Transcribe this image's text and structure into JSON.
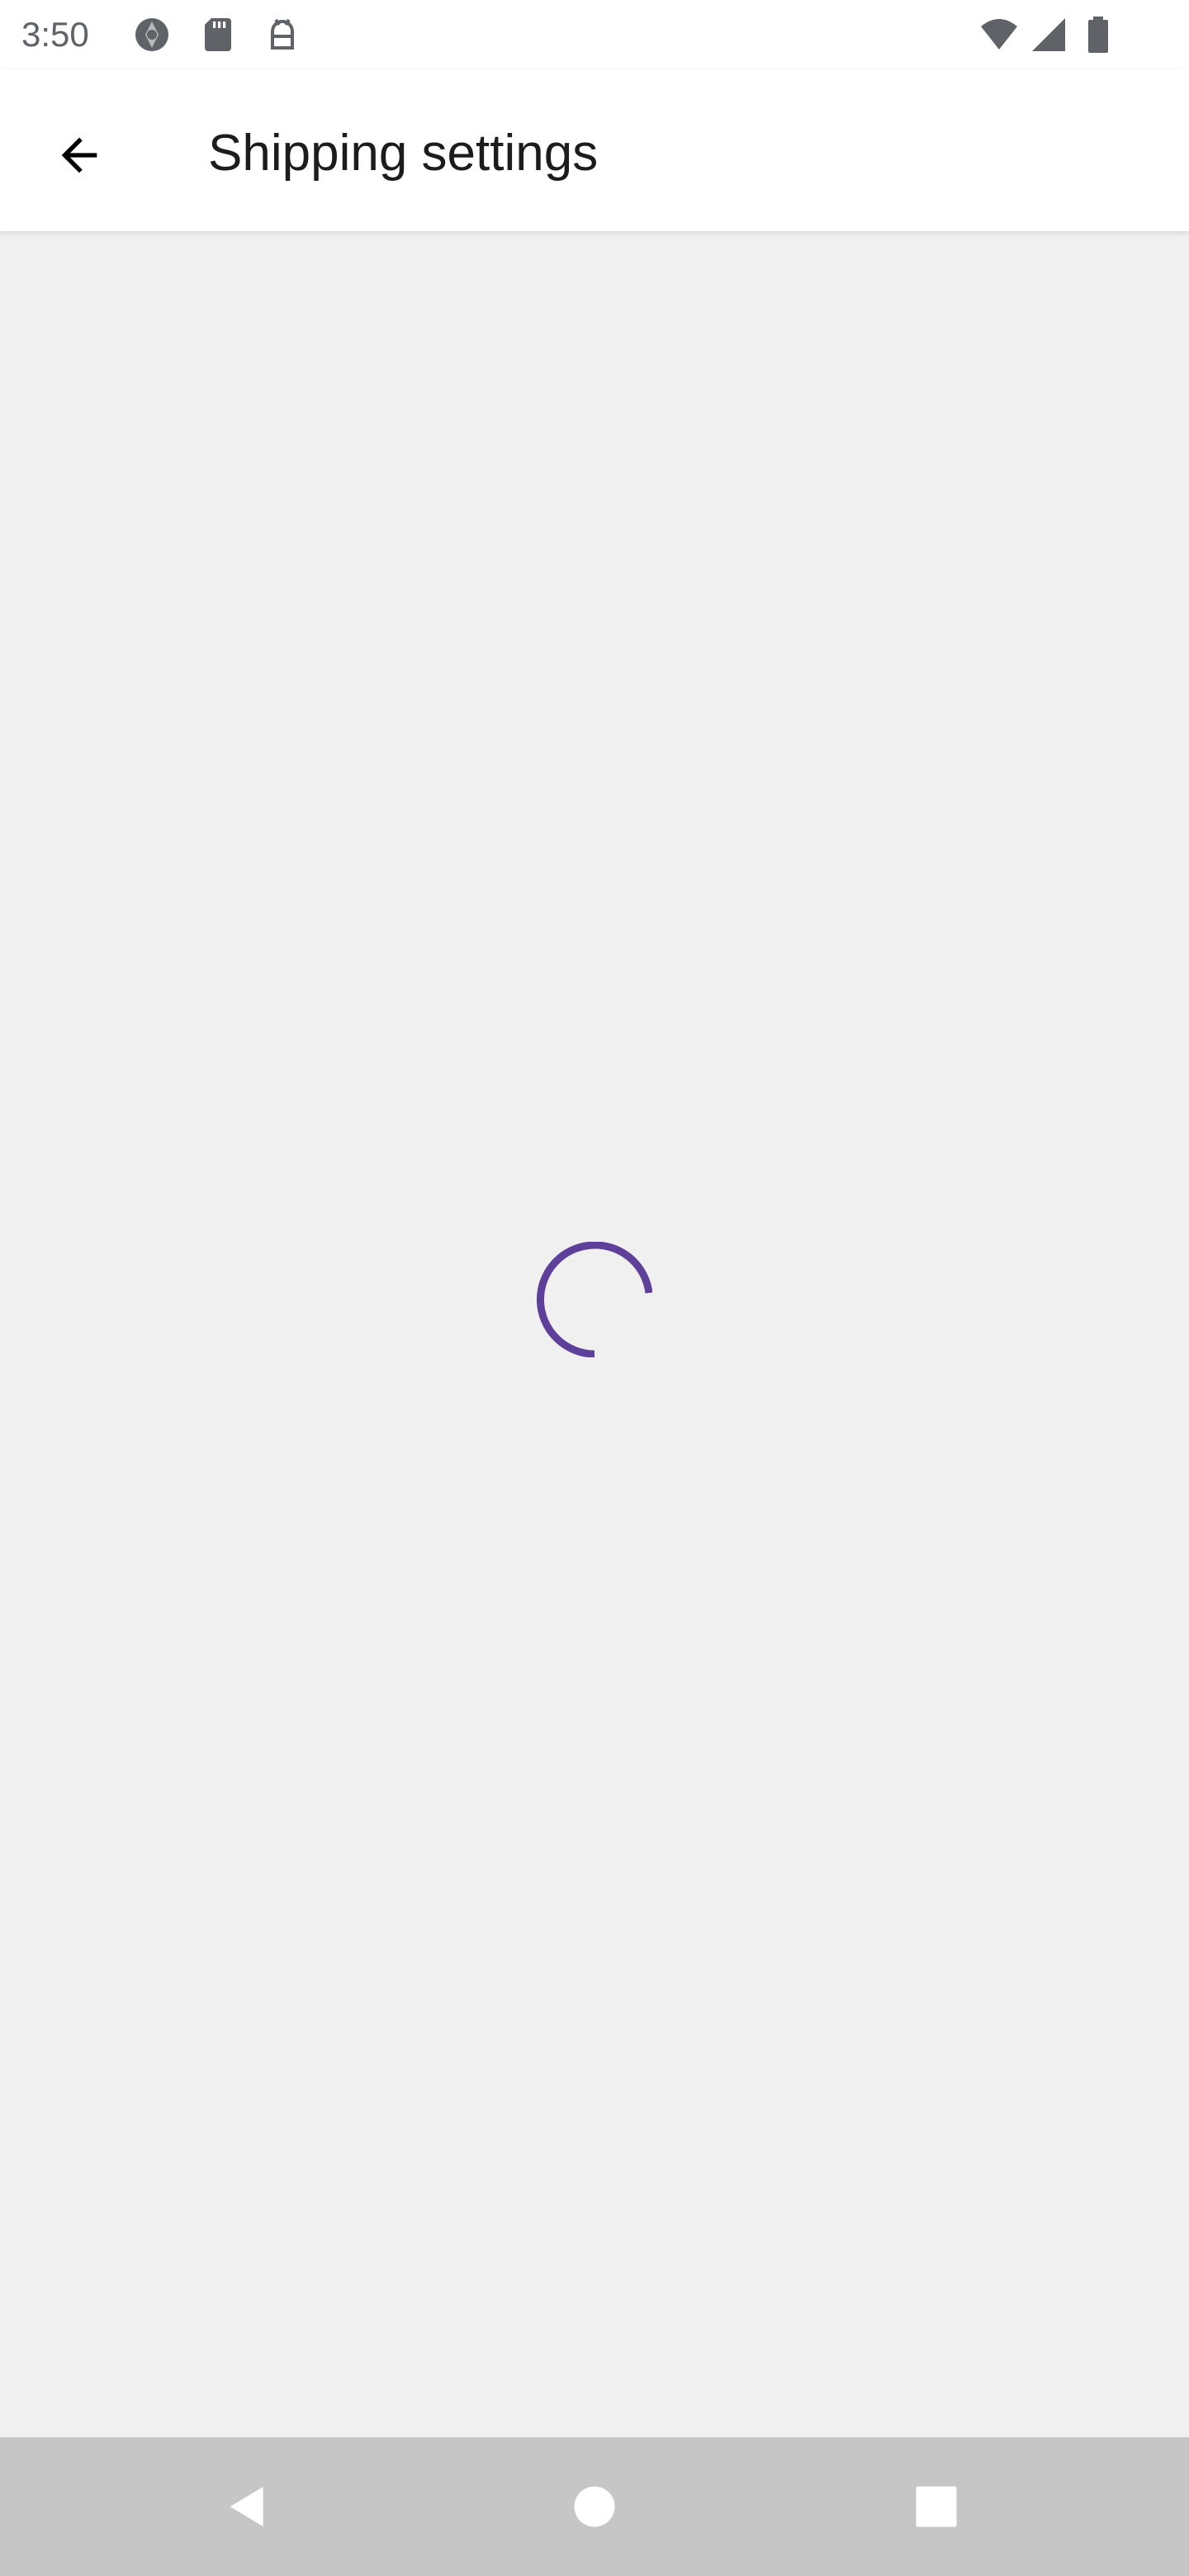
{
  "status_bar": {
    "time": "3:50",
    "left_icons": [
      "camera-shutter-icon",
      "sd-card-icon",
      "android-debug-icon"
    ],
    "right_icons": [
      "wifi-icon",
      "cellular-signal-icon",
      "battery-icon"
    ]
  },
  "app_bar": {
    "back_icon": "arrow-back-icon",
    "title": "Shipping settings"
  },
  "content": {
    "state": "loading",
    "spinner_color": "#5e3f9a",
    "background_color": "#f0f0f0"
  },
  "nav_bar": {
    "buttons": [
      "nav-back-icon",
      "nav-home-icon",
      "nav-recents-icon"
    ],
    "background_color": "#c6c6c6"
  }
}
